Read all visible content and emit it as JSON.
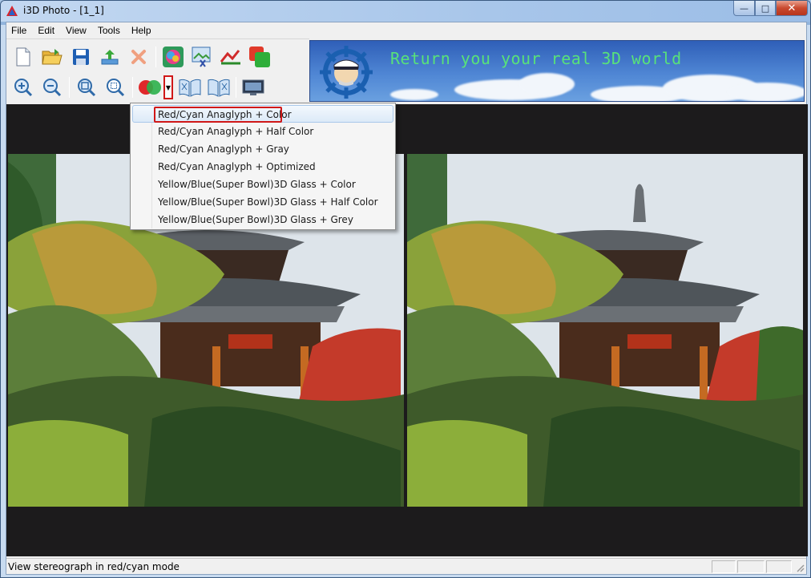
{
  "window": {
    "title": "i3D Photo - [1_1]",
    "controls": {
      "minimize": "—",
      "maximize": "□",
      "close": "✕"
    }
  },
  "menu": [
    "File",
    "Edit",
    "View",
    "Tools",
    "Help"
  ],
  "toolbar": {
    "row1": [
      {
        "name": "new-file-icon"
      },
      {
        "name": "open-folder-icon"
      },
      {
        "name": "save-icon"
      },
      {
        "name": "export-icon"
      },
      {
        "name": "delete-icon"
      },
      {
        "name": "color-effects-icon"
      },
      {
        "name": "image-tool-icon"
      },
      {
        "name": "align-icon"
      },
      {
        "name": "layers-icon"
      }
    ],
    "row2": [
      {
        "name": "zoom-in-icon"
      },
      {
        "name": "zoom-out-icon"
      },
      {
        "name": "zoom-fit-icon"
      },
      {
        "name": "zoom-actual-icon"
      },
      {
        "name": "anaglyph-icon"
      },
      {
        "name": "dropdown-arrow-icon"
      },
      {
        "name": "parallel-view-icon"
      },
      {
        "name": "cross-view-icon"
      },
      {
        "name": "fullscreen-icon"
      }
    ]
  },
  "banner": {
    "text": "Return you your real 3D world"
  },
  "anaglyph_menu": {
    "selected_index": 0,
    "items": [
      "Red/Cyan Anaglyph + Color",
      "Red/Cyan Anaglyph + Half Color",
      "Red/Cyan Anaglyph + Gray",
      "Red/Cyan Anaglyph + Optimized",
      "Yellow/Blue(Super Bowl)3D Glass + Color",
      "Yellow/Blue(Super Bowl)3D Glass + Half Color",
      "Yellow/Blue(Super Bowl)3D Glass + Grey"
    ]
  },
  "status": {
    "text": "View stereograph in red/cyan mode"
  },
  "colors": {
    "highlight": "#d01818",
    "banner_text": "#58e27a",
    "viewer_bg": "#1c1b1c"
  }
}
